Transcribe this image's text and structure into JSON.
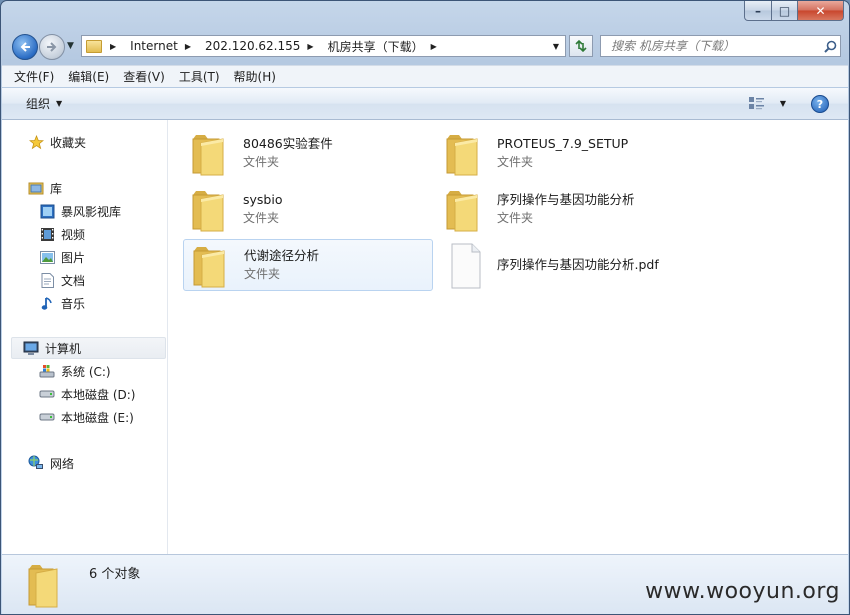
{
  "window": {
    "caption_buttons": {
      "minimize": "–",
      "maximize": "□",
      "close": "✕"
    }
  },
  "address": {
    "breadcrumbs": [
      "Internet",
      "202.120.62.155",
      "机房共享（下载）"
    ],
    "search_placeholder": "搜索 机房共享（下载）"
  },
  "menu": [
    "文件(F)",
    "编辑(E)",
    "查看(V)",
    "工具(T)",
    "帮助(H)"
  ],
  "toolbar": {
    "organize": "组织"
  },
  "nav": {
    "favorites": "收藏夹",
    "libraries": "库",
    "library_items": [
      "暴风影视库",
      "视频",
      "图片",
      "文档",
      "音乐"
    ],
    "computer": "计算机",
    "drives": [
      "系统 (C:)",
      "本地磁盘 (D:)",
      "本地磁盘 (E:)"
    ],
    "network": "网络"
  },
  "items": [
    {
      "name": "80486实验套件",
      "type": "文件夹",
      "kind": "folder"
    },
    {
      "name": "PROTEUS_7.9_SETUP",
      "type": "文件夹",
      "kind": "folder"
    },
    {
      "name": "sysbio",
      "type": "文件夹",
      "kind": "folder"
    },
    {
      "name": "序列操作与基因功能分析",
      "type": "文件夹",
      "kind": "folder"
    },
    {
      "name": "代谢途径分析",
      "type": "文件夹",
      "kind": "folder",
      "selected": true
    },
    {
      "name": "序列操作与基因功能分析.pdf",
      "type": "",
      "kind": "file"
    }
  ],
  "status": {
    "count_text": "6 个对象"
  },
  "watermark": "www.wooyun.org",
  "colors": {
    "accent": "#1c5bb3",
    "folder": "#e8c25a",
    "selection": "#b9d3f0"
  }
}
